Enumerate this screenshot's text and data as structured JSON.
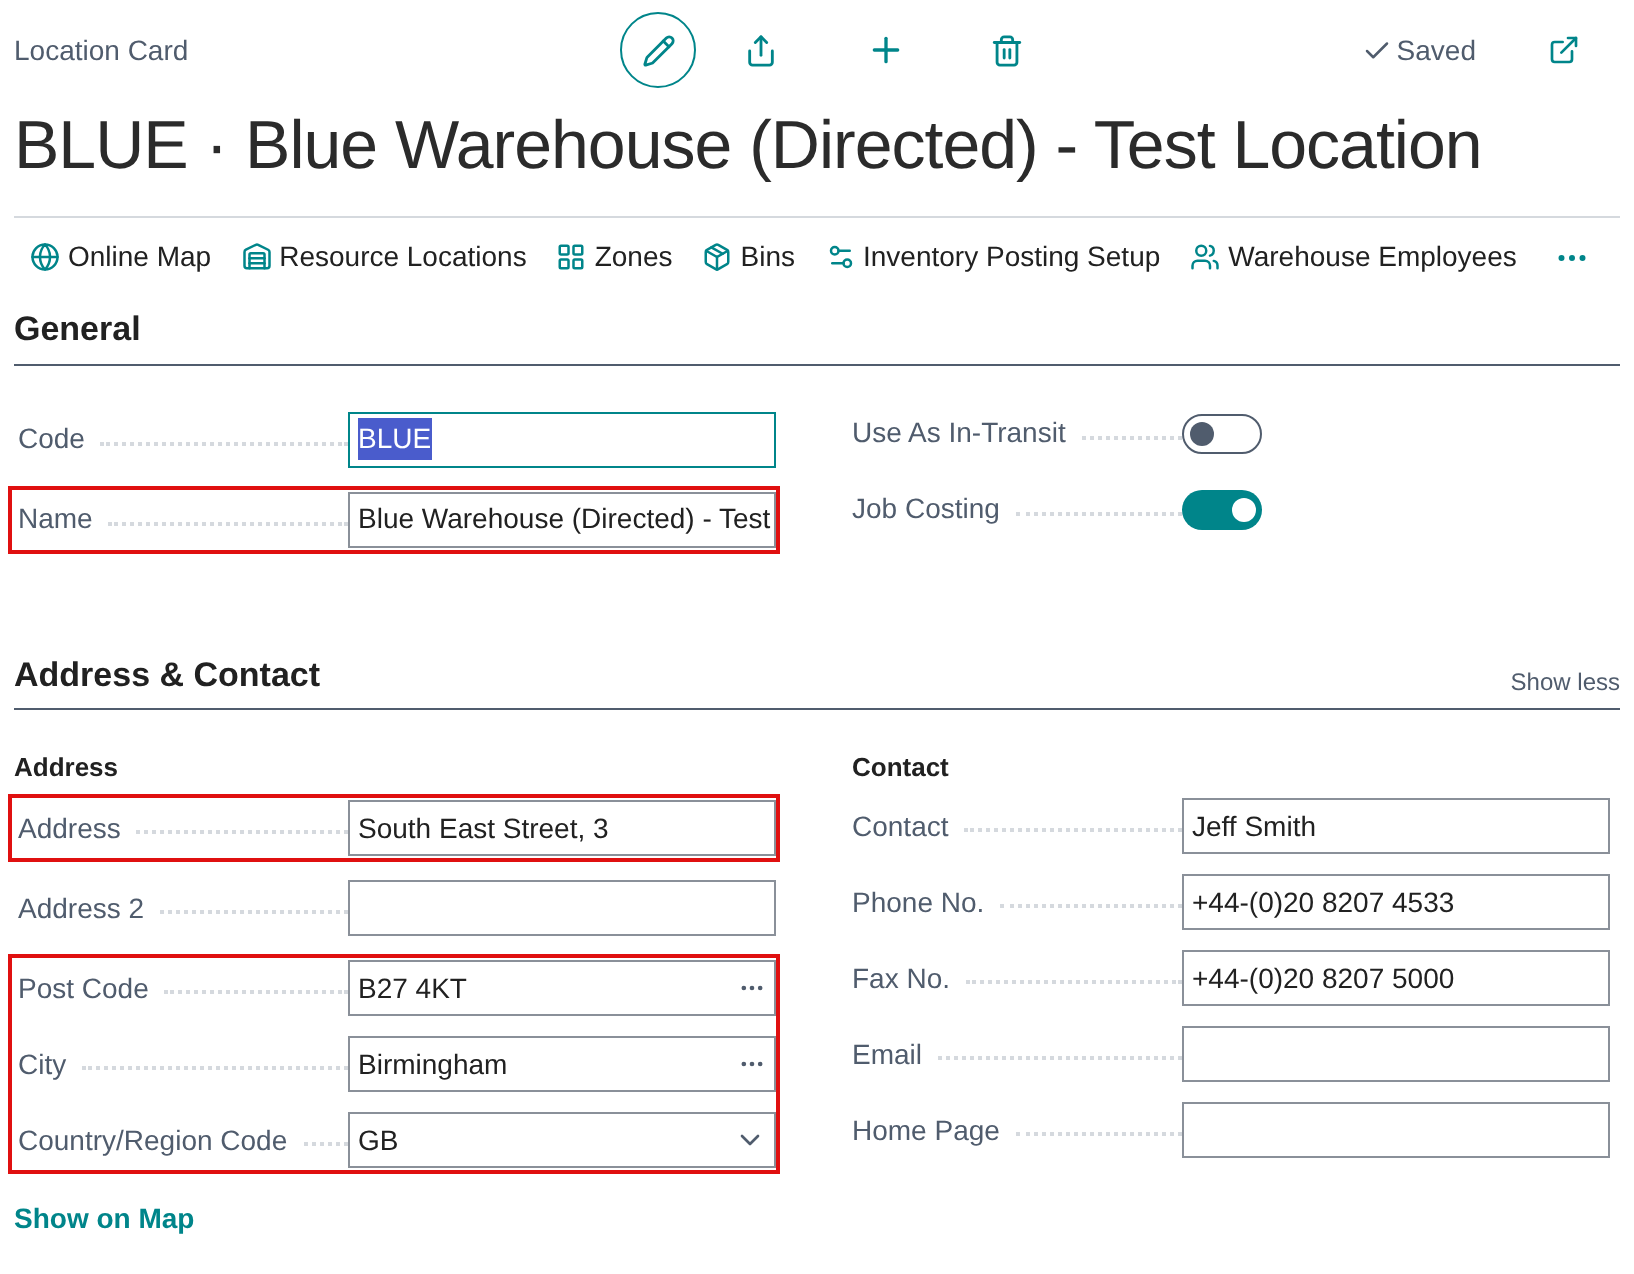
{
  "page_type": "Location Card",
  "header_actions": {
    "saved": "Saved"
  },
  "title": "BLUE · Blue Warehouse (Directed) - Test Location",
  "action_bar": [
    {
      "label": "Online Map",
      "kind": "map"
    },
    {
      "label": "Resource Locations",
      "kind": "resource"
    },
    {
      "label": "Zones",
      "kind": "zones"
    },
    {
      "label": "Bins",
      "kind": "bins"
    },
    {
      "label": "Inventory Posting Setup",
      "kind": "setup"
    },
    {
      "label": "Warehouse Employees",
      "kind": "employees"
    }
  ],
  "general": {
    "heading": "General",
    "left_groups": [
      {
        "highlighted": false,
        "fields": [
          {
            "label": "Code",
            "value": "BLUE",
            "kind": "text",
            "focused": true
          }
        ]
      },
      {
        "highlighted": true,
        "fields": [
          {
            "label": "Name",
            "value": "Blue Warehouse (Directed) - Test",
            "kind": "text",
            "focused": false
          }
        ]
      }
    ],
    "toggles": [
      {
        "label": "Use As In-Transit",
        "on": false
      },
      {
        "label": "Job Costing",
        "on": true
      }
    ]
  },
  "address_contact": {
    "heading": "Address & Contact",
    "show_less": "Show less",
    "address_heading": "Address",
    "address_groups": [
      {
        "highlighted": true,
        "fields": [
          {
            "label": "Address",
            "value": "South East Street, 3",
            "kind": "text",
            "focused": false
          }
        ]
      },
      {
        "highlighted": false,
        "fields": [
          {
            "label": "Address 2",
            "kind": "text",
            "focused": false
          }
        ]
      },
      {
        "highlighted": true,
        "fields": [
          {
            "label": "Post Code",
            "value": "B27 4KT",
            "kind": "lookup",
            "focused": false
          },
          {
            "label": "City",
            "value": "Birmingham",
            "kind": "lookup",
            "focused": false
          },
          {
            "label": "Country/Region Code",
            "value": "GB",
            "kind": "dropdown",
            "focused": false
          }
        ]
      }
    ],
    "contact_heading": "Contact",
    "contact_fields": [
      {
        "label": "Contact",
        "value": "Jeff Smith",
        "kind": "text"
      },
      {
        "label": "Phone No.",
        "value": "+44-(0)20 8207 4533",
        "kind": "text"
      },
      {
        "label": "Fax No.",
        "value": "+44-(0)20 8207 5000",
        "kind": "text"
      },
      {
        "label": "Email",
        "kind": "text"
      },
      {
        "label": "Home Page",
        "kind": "text"
      }
    ],
    "show_on_map": "Show on Map"
  }
}
